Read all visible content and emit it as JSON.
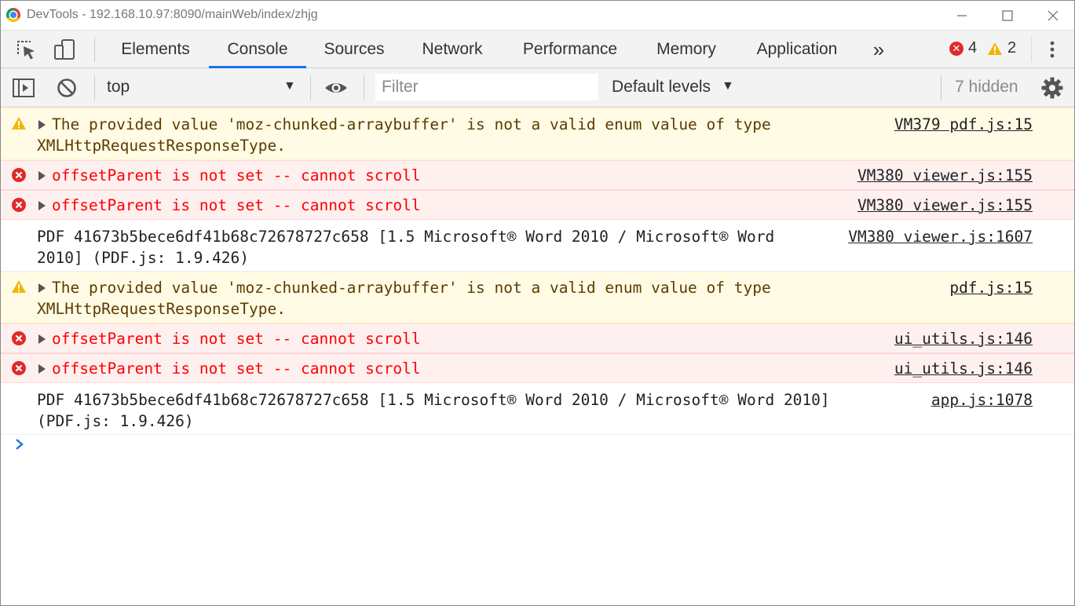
{
  "window": {
    "title": "DevTools - 192.168.10.97:8090/mainWeb/index/zhjg"
  },
  "tabs": [
    {
      "label": "Elements"
    },
    {
      "label": "Console"
    },
    {
      "label": "Sources"
    },
    {
      "label": "Network"
    },
    {
      "label": "Performance"
    },
    {
      "label": "Memory"
    },
    {
      "label": "Application"
    }
  ],
  "more_tabs": "»",
  "counts": {
    "errors": "4",
    "warnings": "2"
  },
  "console_toolbar": {
    "context": "top",
    "filter_placeholder": "Filter",
    "levels": "Default levels",
    "hidden": "7 hidden"
  },
  "messages": [
    {
      "level": "warn",
      "line1": "The provided value 'moz-chunked-arraybuffer' is not a valid enum value of type",
      "line2": "XMLHttpRequestResponseType.",
      "source": "VM379 pdf.js:15"
    },
    {
      "level": "error",
      "line1": "offsetParent is not set -- cannot scroll",
      "source": "VM380 viewer.js:155"
    },
    {
      "level": "error",
      "line1": "offsetParent is not set -- cannot scroll",
      "source": "VM380 viewer.js:155"
    },
    {
      "level": "log",
      "line1": "PDF 41673b5bece6df41b68c72678727c658 [1.5 Microsoft® Word 2010 / Microsoft® Word",
      "line2": "2010] (PDF.js: 1.9.426)",
      "source": "VM380 viewer.js:1607"
    },
    {
      "level": "warn",
      "line1": "The provided value 'moz-chunked-arraybuffer' is not a valid enum value of type",
      "line2": "XMLHttpRequestResponseType.",
      "source": "pdf.js:15"
    },
    {
      "level": "error",
      "line1": "offsetParent is not set -- cannot scroll",
      "source": "ui_utils.js:146"
    },
    {
      "level": "error",
      "line1": "offsetParent is not set -- cannot scroll",
      "source": "ui_utils.js:146"
    },
    {
      "level": "log",
      "line1": "PDF 41673b5bece6df41b68c72678727c658 [1.5 Microsoft® Word 2010 / Microsoft® Word 2010]",
      "line2": "(PDF.js: 1.9.426)",
      "source": "app.js:1078"
    }
  ],
  "colors": {
    "active_tab_underline": "#1a73e8",
    "warn_bg": "#fffbe5",
    "error_bg": "#fff0f0",
    "error_text": "#ff0000",
    "warn_text": "#5c3c00"
  }
}
